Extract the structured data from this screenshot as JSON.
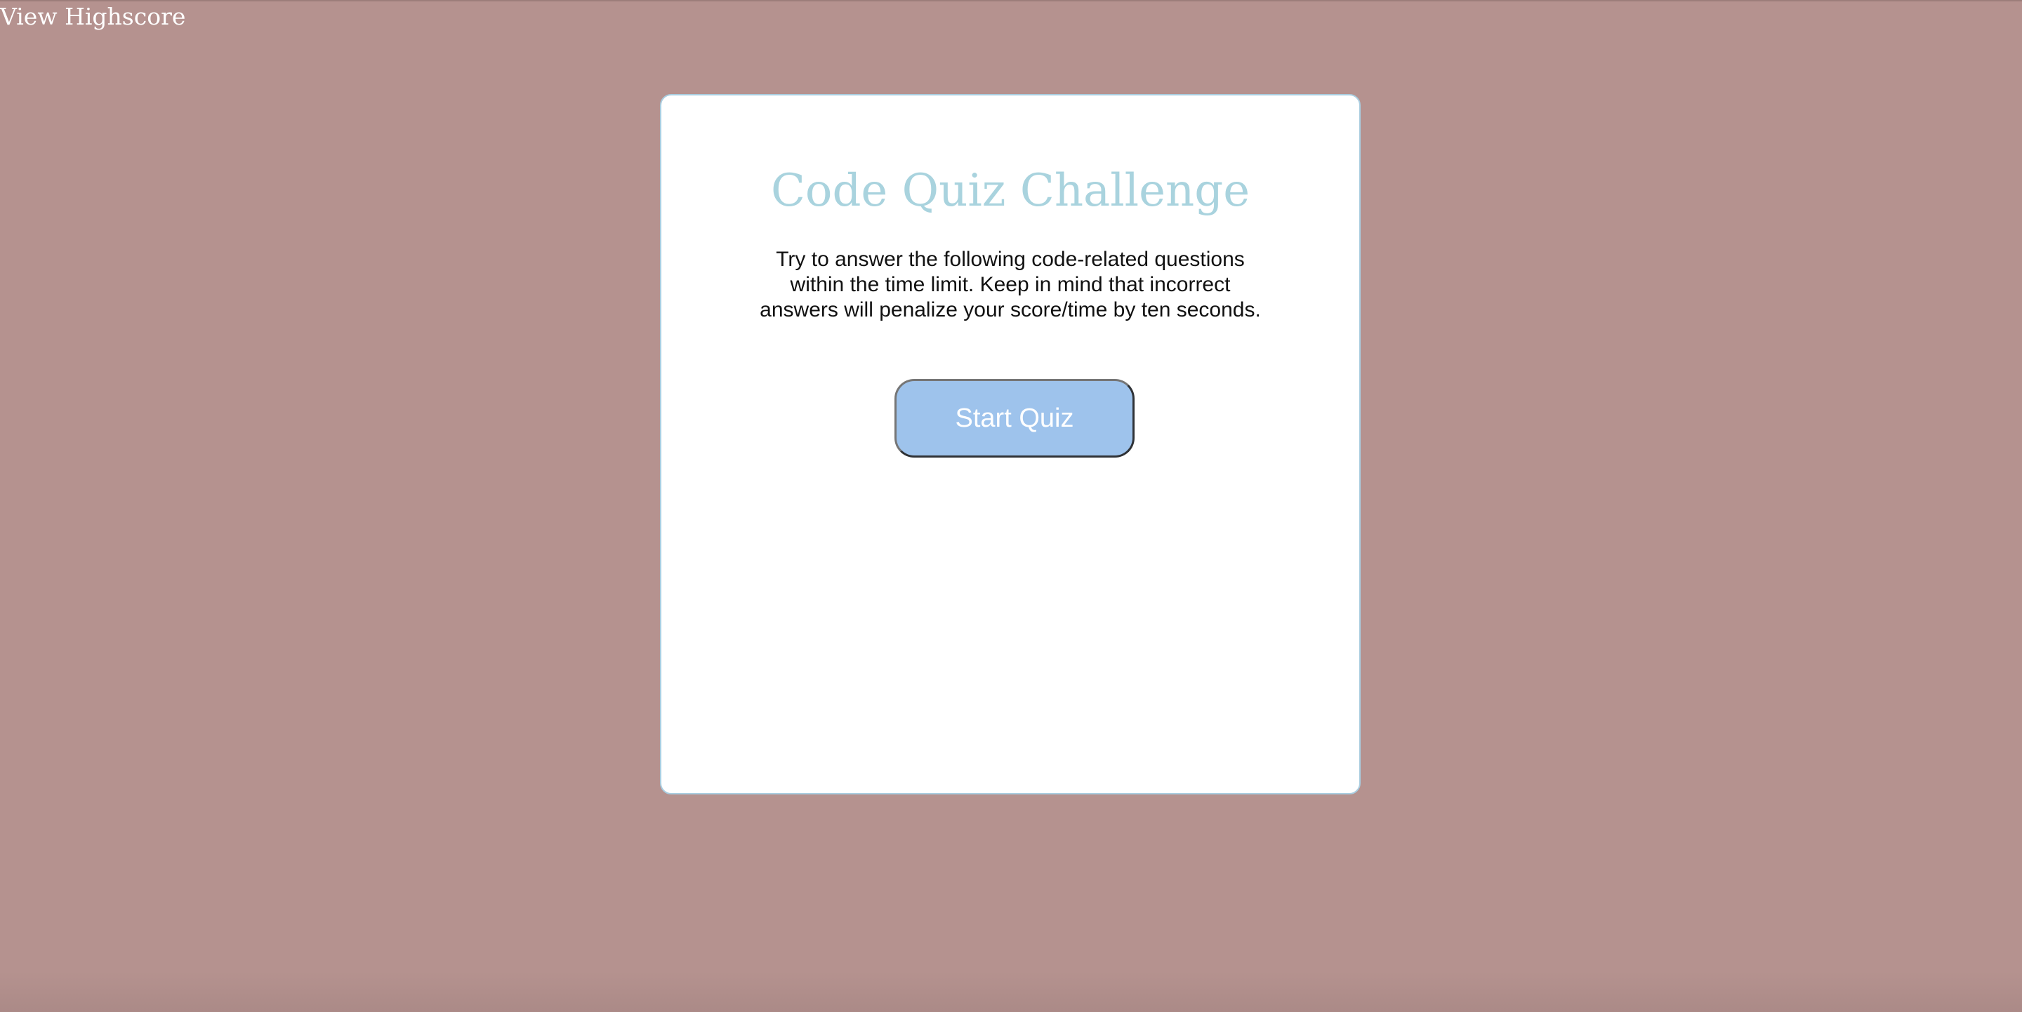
{
  "header": {
    "view_highscore_label": "View Highscore"
  },
  "quiz": {
    "title": "Code Quiz Challenge",
    "intro": "Try to answer the following code-related questions within the time limit. Keep in mind that incorrect answers will penalize your score/time by ten seconds.",
    "start_button_label": "Start Quiz"
  },
  "colors": {
    "page_background": "#b5928f",
    "card_background": "#ffffff",
    "card_border": "#a9cde0",
    "title_color": "#a9d3de",
    "button_background": "#9ec3ec",
    "button_text": "#ffffff",
    "intro_text": "#111111",
    "header_link": "#ffffff"
  }
}
